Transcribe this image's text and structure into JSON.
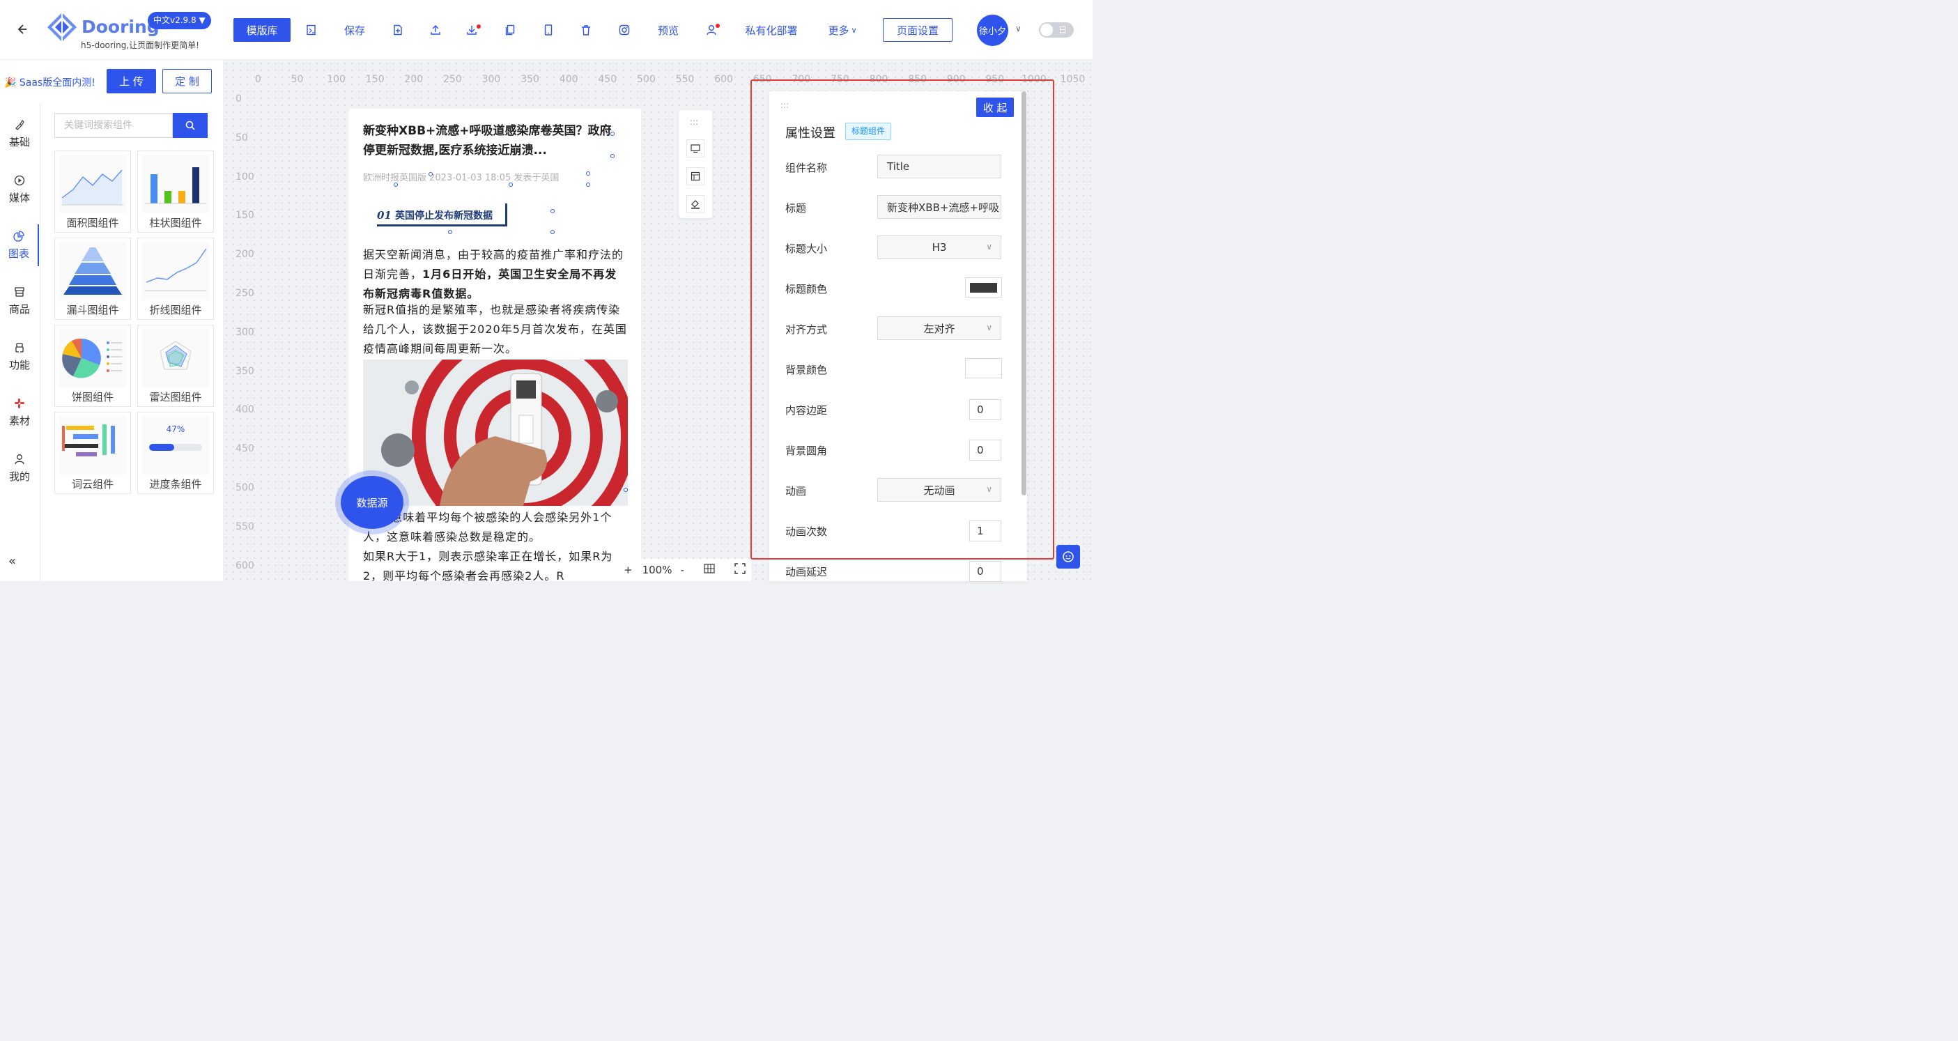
{
  "header": {
    "logo_name": "Dooring",
    "tagline": "h5-dooring,让页面制作更简单!",
    "version": "中文v2.9.8",
    "toolbar": {
      "template_lib": "模版库",
      "save": "保存",
      "preview": "预览",
      "private_deploy": "私有化部署",
      "more": "更多",
      "page_settings": "页面设置"
    },
    "user_name": "徐小夕",
    "theme_toggle": "日"
  },
  "promo": {
    "text": "🎉 Saas版全面内测!",
    "upload": "上 传",
    "custom": "定 制"
  },
  "sidebar": {
    "items": [
      {
        "label": "基础",
        "icon": "brush-icon"
      },
      {
        "label": "媒体",
        "icon": "play-icon"
      },
      {
        "label": "图表",
        "icon": "pie-chart-icon"
      },
      {
        "label": "商品",
        "icon": "shop-icon"
      },
      {
        "label": "功能",
        "icon": "function-icon"
      },
      {
        "label": "素材",
        "icon": "material-icon"
      },
      {
        "label": "我的",
        "icon": "user-icon"
      }
    ],
    "active": "图表"
  },
  "components": {
    "search_placeholder": "关键词搜索组件",
    "cards": [
      {
        "label": "面积图组件"
      },
      {
        "label": "柱状图组件"
      },
      {
        "label": "漏斗图组件"
      },
      {
        "label": "折线图组件"
      },
      {
        "label": "饼图组件"
      },
      {
        "label": "雷达图组件"
      },
      {
        "label": "词云组件"
      },
      {
        "label": "进度条组件",
        "percent_text": "47%",
        "progress": 0.47
      }
    ]
  },
  "ruler": {
    "top": [
      "0",
      "50",
      "100",
      "150",
      "200",
      "250",
      "300",
      "350",
      "400",
      "450",
      "500",
      "550",
      "600",
      "650",
      "700",
      "750",
      "800",
      "850",
      "900",
      "950",
      "1000",
      "1050"
    ],
    "left": [
      "0",
      "50",
      "100",
      "150",
      "200",
      "250",
      "300",
      "350",
      "400",
      "450",
      "500",
      "550",
      "600"
    ]
  },
  "article": {
    "title": "新变种XBB+流感+呼吸道感染席卷英国？政府停更新冠数据,医疗系统接近崩溃...",
    "meta": "欧洲时报英国版 2023-01-03 18:05 发表于英国",
    "section_num": "01",
    "section_title": "英国停止发布新冠数据",
    "p1_a": "据天空新闻消息，由于较高的疫苗推广率和疗法的日渐完善，",
    "p1_b": "1月6日开始，英国卫生安全局不再发布新冠病毒R值数据。",
    "p2": "新冠R值指的是繁殖率，也就是感染者将疾病传染给几个人，该数据于2020年5月首次发布，在英国疫情高峰期间每周更新一次。",
    "p3": "R为1意味着平均每个被感染的人会感染另外1个人，这意味着感染总数是稳定的。",
    "p4": "如果R大于1，则表示感染率正在增长，如果R为 2，则平均每个感染者会再感染2人。R"
  },
  "datasource_btn": "数据源",
  "zoom": {
    "plus": "+",
    "value": "100%",
    "minus": "-"
  },
  "props": {
    "title": "属性设置",
    "tag": "标题组件",
    "collapse": "收 起",
    "rows": [
      {
        "label": "组件名称",
        "value": "Title"
      },
      {
        "label": "标题",
        "value": "新变种XBB+流感+呼吸"
      },
      {
        "label": "标题大小",
        "value": "H3"
      },
      {
        "label": "标题颜色",
        "value": "#3a3a3a"
      },
      {
        "label": "对齐方式",
        "value": "左对齐"
      },
      {
        "label": "背景颜色",
        "value": "#ffffff"
      },
      {
        "label": "内容边距",
        "value": "0"
      },
      {
        "label": "背景圆角",
        "value": "0"
      },
      {
        "label": "动画",
        "value": "无动画"
      },
      {
        "label": "动画次数",
        "value": "1"
      },
      {
        "label": "动画延迟",
        "value": "0"
      }
    ]
  },
  "colors": {
    "accent": "#2f54eb",
    "highlight_border": "#e53935"
  }
}
